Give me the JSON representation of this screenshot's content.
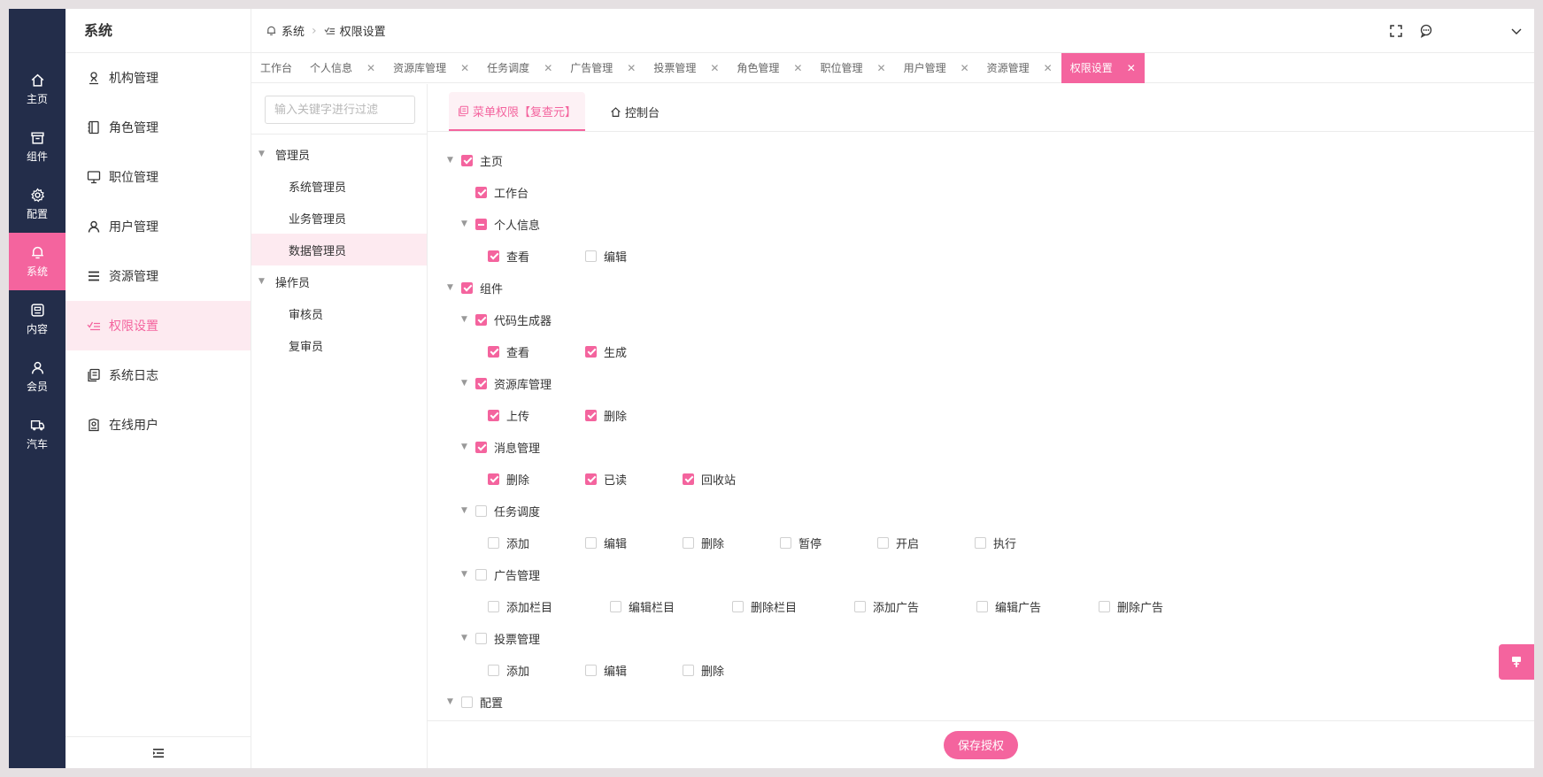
{
  "colors": {
    "accent": "#f4649e",
    "rail_bg": "#232d4a",
    "active_bg": "#fdeaf0"
  },
  "rail": {
    "items": [
      {
        "label": "主页",
        "icon": "home-icon"
      },
      {
        "label": "组件",
        "icon": "box-icon"
      },
      {
        "label": "配置",
        "icon": "gear-icon"
      },
      {
        "label": "系统",
        "icon": "bell-icon",
        "active": true
      },
      {
        "label": "内容",
        "icon": "content-icon"
      },
      {
        "label": "会员",
        "icon": "user-icon"
      },
      {
        "label": "汽车",
        "icon": "truck-icon"
      }
    ]
  },
  "submenu": {
    "title": "系统",
    "items": [
      {
        "label": "机构管理",
        "icon": "org-icon"
      },
      {
        "label": "角色管理",
        "icon": "notebook-icon"
      },
      {
        "label": "职位管理",
        "icon": "monitor-icon"
      },
      {
        "label": "用户管理",
        "icon": "user-icon"
      },
      {
        "label": "资源管理",
        "icon": "list-icon"
      },
      {
        "label": "权限设置",
        "icon": "checklist-icon",
        "active": true
      },
      {
        "label": "系统日志",
        "icon": "document-icon"
      },
      {
        "label": "在线用户",
        "icon": "badge-icon"
      }
    ]
  },
  "header": {
    "breadcrumb": [
      "系统",
      "权限设置"
    ]
  },
  "tabs": [
    {
      "label": "工作台",
      "closable": false
    },
    {
      "label": "个人信息",
      "closable": true
    },
    {
      "label": "资源库管理",
      "closable": true
    },
    {
      "label": "任务调度",
      "closable": true
    },
    {
      "label": "广告管理",
      "closable": true
    },
    {
      "label": "投票管理",
      "closable": true
    },
    {
      "label": "角色管理",
      "closable": true
    },
    {
      "label": "职位管理",
      "closable": true
    },
    {
      "label": "用户管理",
      "closable": true
    },
    {
      "label": "资源管理",
      "closable": true
    },
    {
      "label": "权限设置",
      "closable": true,
      "active": true
    }
  ],
  "roles": {
    "filter_placeholder": "输入关键字进行过滤",
    "groups": [
      {
        "label": "管理员",
        "children": [
          "系统管理员",
          "业务管理员",
          "数据管理员"
        ]
      },
      {
        "label": "操作员",
        "children": [
          "审核员",
          "复审员"
        ]
      }
    ]
  },
  "perm": {
    "tabs": [
      {
        "label": "菜单权限【复查元】",
        "icon": "copy-icon",
        "active": true
      },
      {
        "label": "控制台",
        "icon": "home-icon",
        "active": false
      }
    ],
    "tree": [
      {
        "level": 0,
        "label": "主页",
        "state": "checked",
        "expandable": true
      },
      {
        "level": 1,
        "label": "工作台",
        "state": "checked",
        "expandable": false
      },
      {
        "level": 1,
        "label": "个人信息",
        "state": "partial",
        "expandable": true
      },
      {
        "level": 2,
        "leaves": [
          {
            "label": "查看",
            "state": "checked"
          },
          {
            "label": "编辑",
            "state": "none"
          }
        ]
      },
      {
        "level": 0,
        "label": "组件",
        "state": "checked",
        "expandable": true
      },
      {
        "level": 1,
        "label": "代码生成器",
        "state": "checked",
        "expandable": true
      },
      {
        "level": 2,
        "leaves": [
          {
            "label": "查看",
            "state": "checked"
          },
          {
            "label": "生成",
            "state": "checked"
          }
        ]
      },
      {
        "level": 1,
        "label": "资源库管理",
        "state": "checked",
        "expandable": true
      },
      {
        "level": 2,
        "leaves": [
          {
            "label": "上传",
            "state": "checked"
          },
          {
            "label": "删除",
            "state": "checked"
          }
        ]
      },
      {
        "level": 1,
        "label": "消息管理",
        "state": "checked",
        "expandable": true
      },
      {
        "level": 2,
        "leaves": [
          {
            "label": "删除",
            "state": "checked"
          },
          {
            "label": "已读",
            "state": "checked"
          },
          {
            "label": "回收站",
            "state": "checked"
          }
        ]
      },
      {
        "level": 1,
        "label": "任务调度",
        "state": "none",
        "expandable": true
      },
      {
        "level": 2,
        "leaves": [
          {
            "label": "添加",
            "state": "none"
          },
          {
            "label": "编辑",
            "state": "none"
          },
          {
            "label": "删除",
            "state": "none"
          },
          {
            "label": "暂停",
            "state": "none"
          },
          {
            "label": "开启",
            "state": "none"
          },
          {
            "label": "执行",
            "state": "none"
          }
        ]
      },
      {
        "level": 1,
        "label": "广告管理",
        "state": "none",
        "expandable": true
      },
      {
        "level": 2,
        "wide": true,
        "leaves": [
          {
            "label": "添加栏目",
            "state": "none"
          },
          {
            "label": "编辑栏目",
            "state": "none"
          },
          {
            "label": "删除栏目",
            "state": "none"
          },
          {
            "label": "添加广告",
            "state": "none"
          },
          {
            "label": "编辑广告",
            "state": "none"
          },
          {
            "label": "删除广告",
            "state": "none"
          }
        ]
      },
      {
        "level": 1,
        "label": "投票管理",
        "state": "none",
        "expandable": true
      },
      {
        "level": 2,
        "leaves": [
          {
            "label": "添加",
            "state": "none"
          },
          {
            "label": "编辑",
            "state": "none"
          },
          {
            "label": "删除",
            "state": "none"
          }
        ]
      },
      {
        "level": 0,
        "label": "配置",
        "state": "none",
        "expandable": true
      }
    ],
    "save_label": "保存授权"
  }
}
